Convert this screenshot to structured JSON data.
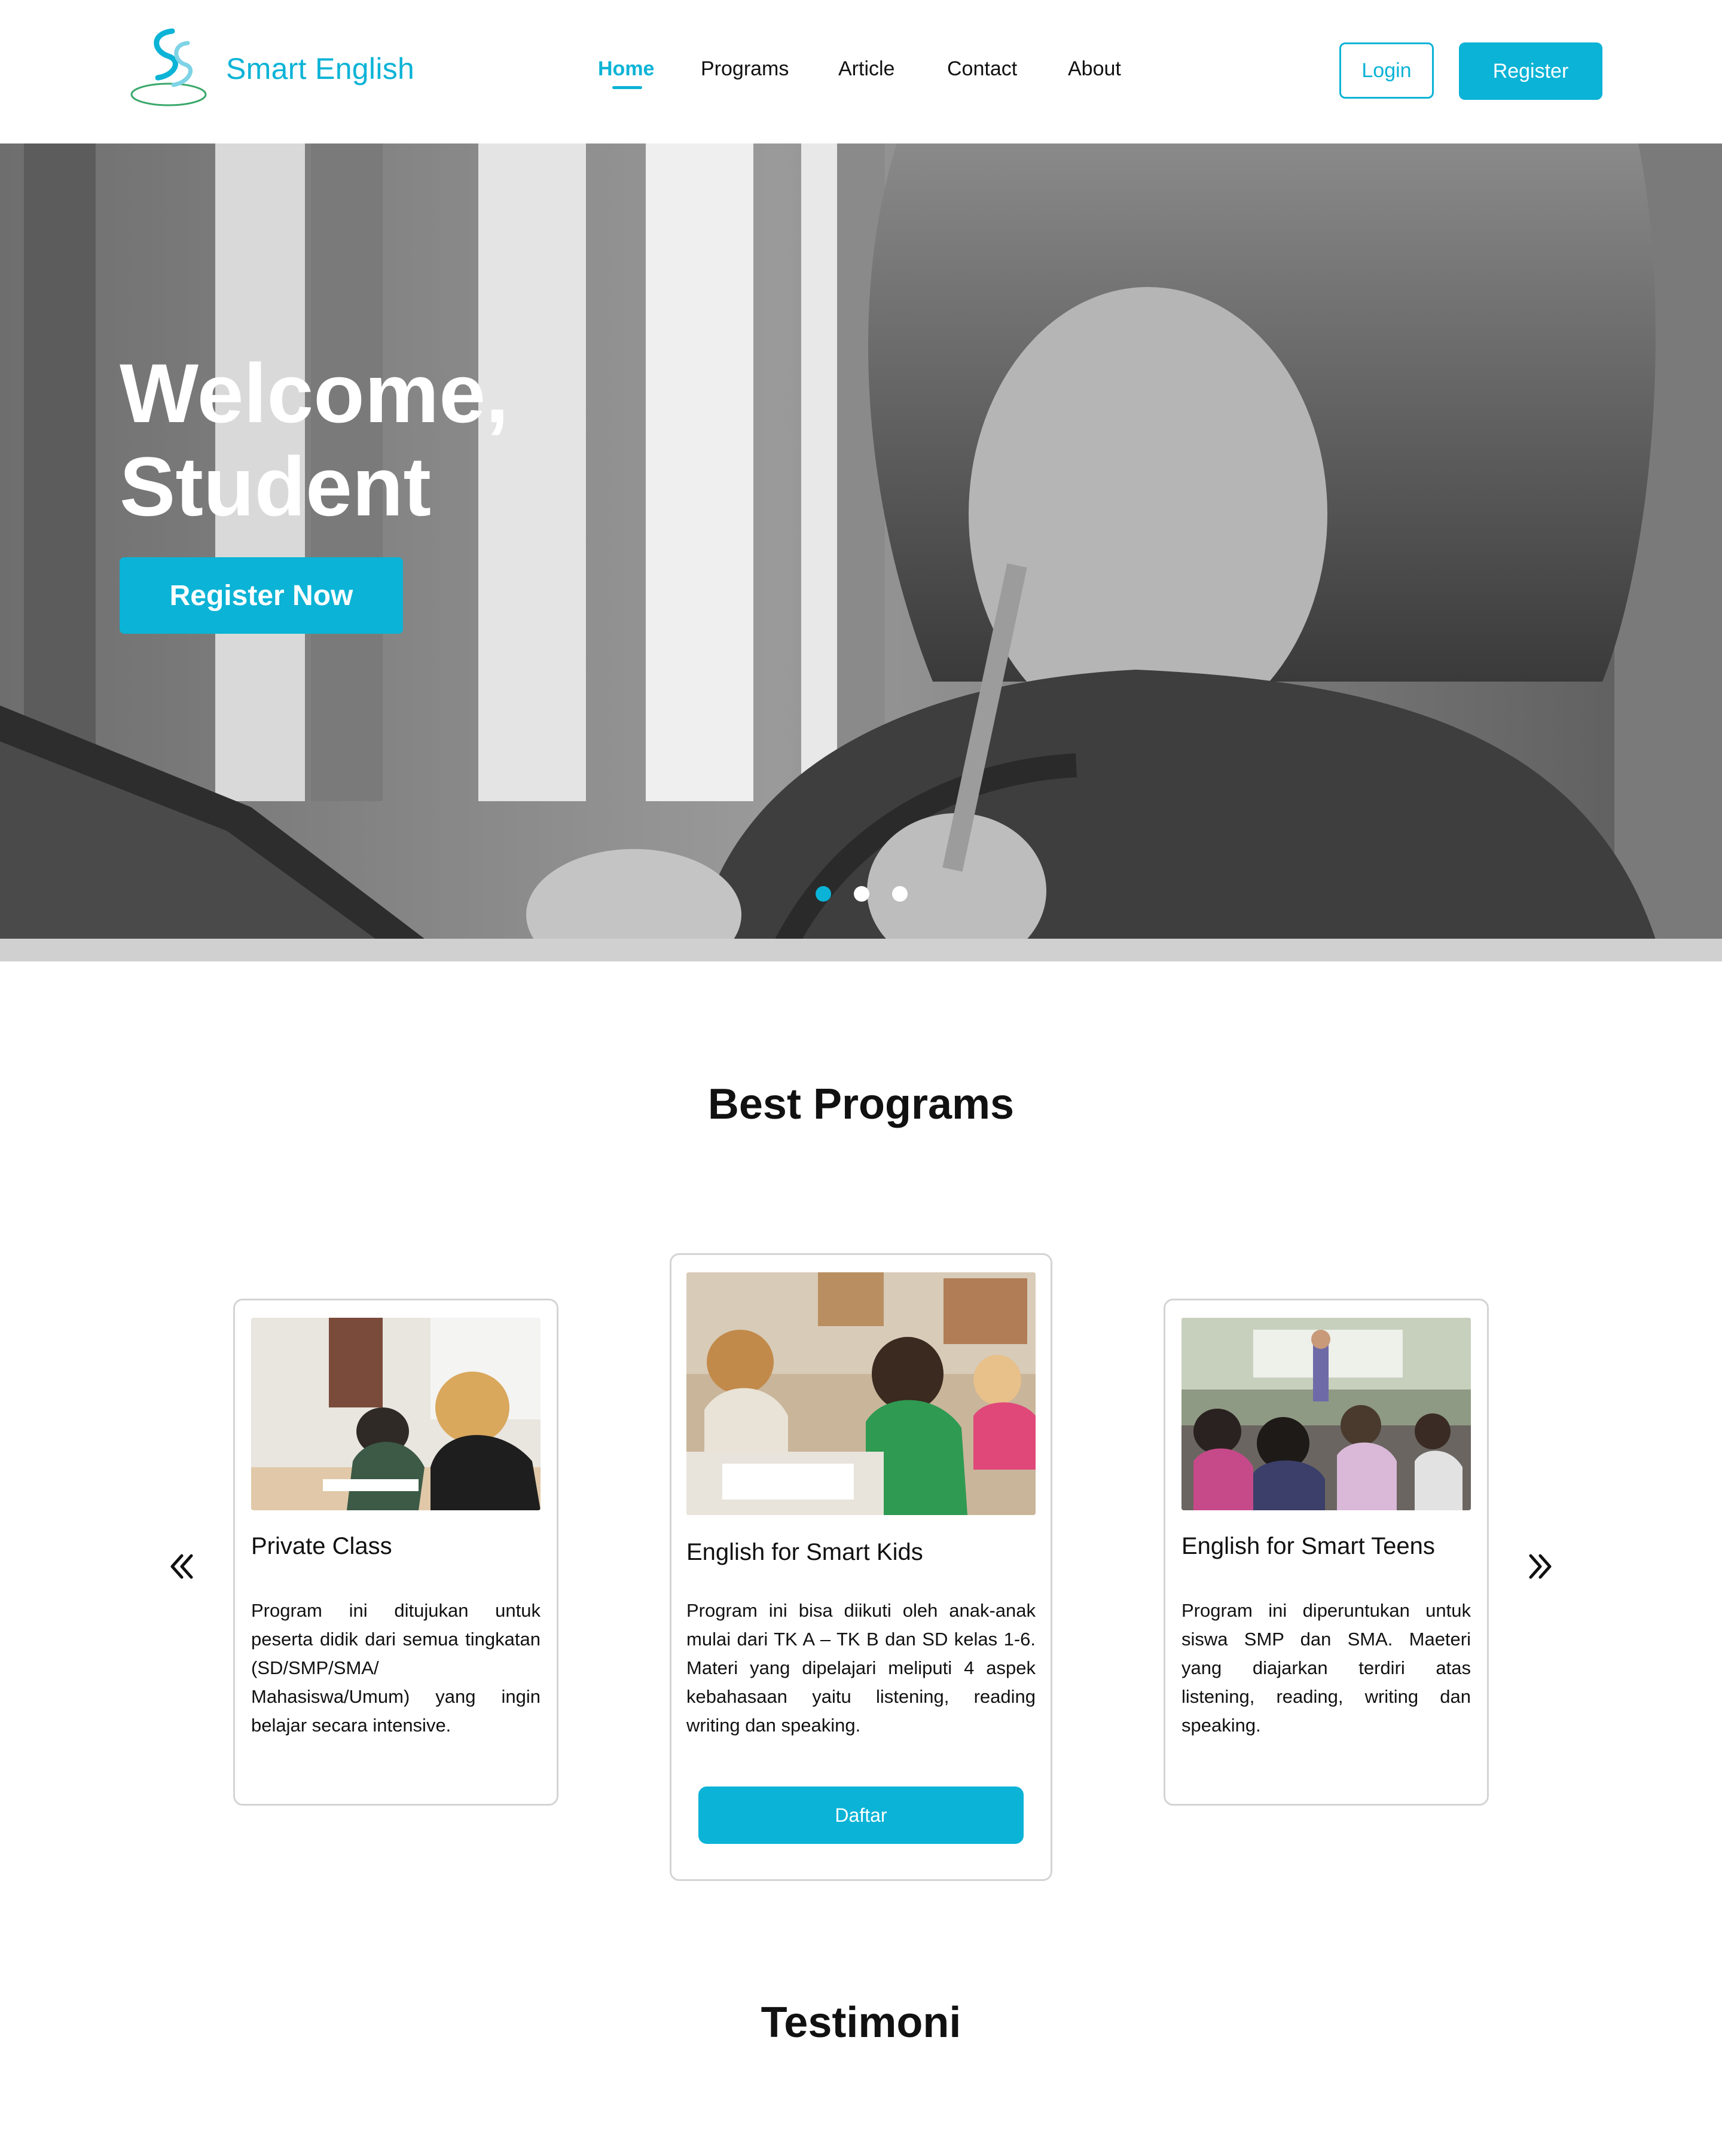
{
  "brand": {
    "name": "Smart English",
    "logo_icon": "ss-swirl-logo-icon",
    "accent_color": "#0bb3d6"
  },
  "nav": {
    "links": [
      "Home",
      "Programs",
      "Article",
      "Contact",
      "About"
    ],
    "active": "Home",
    "login_label": "Login",
    "register_label": "Register"
  },
  "hero": {
    "title_line1": "Welcome,",
    "title_line2": "Student",
    "cta_label": "Register Now",
    "slides_total": 3,
    "active_slide": 1
  },
  "programs": {
    "section_title": "Best Programs",
    "prev_icon": "double-chevron-left-icon",
    "next_icon": "double-chevron-right-icon",
    "cards": [
      {
        "title": "Private Class",
        "description": "Program ini ditujukan untuk peserta didik dari semua tingkatan (SD/SMP/SMA/ Mahasiswa/Umum) yang ingin belajar secara intensive."
      },
      {
        "title": "English for Smart Kids",
        "description": "Program ini bisa diikuti oleh anak-anak mulai dari TK A – TK B dan SD kelas 1-6. Materi yang dipelajari meliputi 4 aspek kebahasaan yaitu listening, reading writing dan speaking.",
        "button_label": "Daftar"
      },
      {
        "title": "English for Smart Teens",
        "description": "Program ini diperuntukan untuk siswa SMP dan SMA. Maeteri yang diajarkan terdiri atas listening, reading, writing dan speaking."
      }
    ]
  },
  "testimoni": {
    "section_title": "Testimoni"
  }
}
